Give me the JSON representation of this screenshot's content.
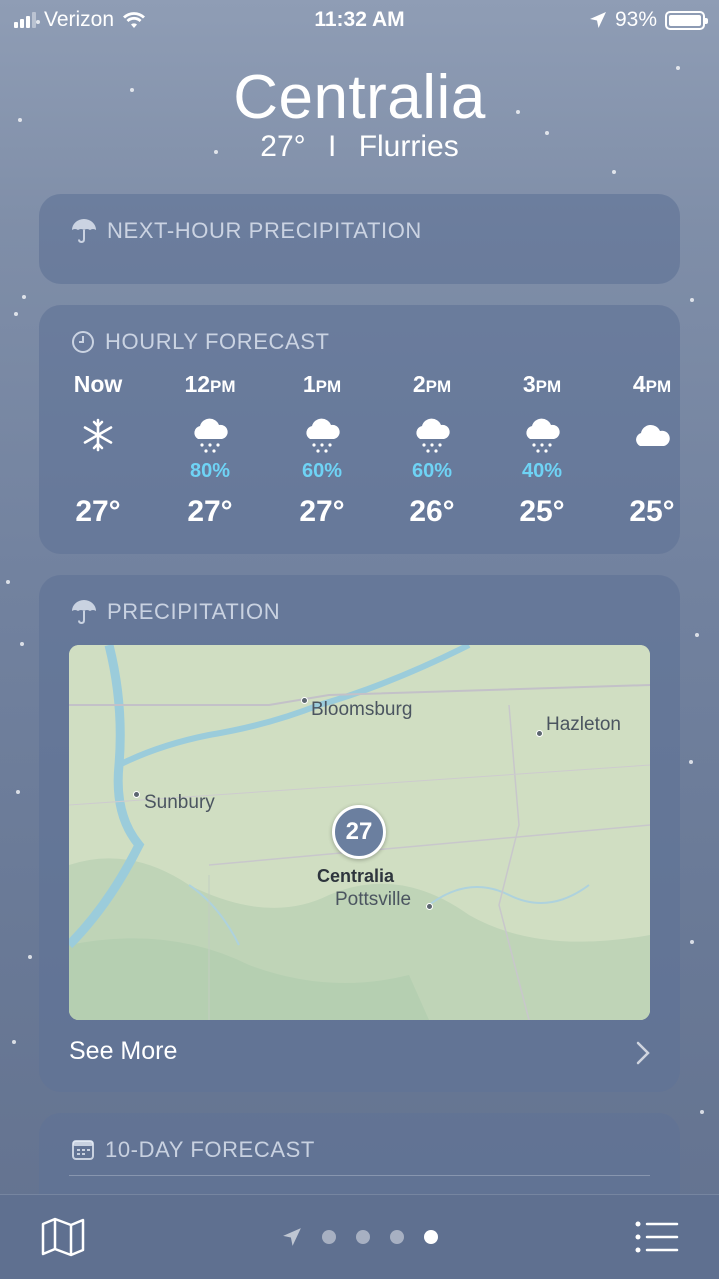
{
  "status_bar": {
    "carrier": "Verizon",
    "time": "11:32 AM",
    "battery": "93%"
  },
  "header": {
    "city": "Centralia",
    "temp": "27°",
    "separator": "I",
    "condition": "Flurries"
  },
  "next_hour": {
    "title": "NEXT-HOUR PRECIPITATION",
    "icon": "umbrella-icon"
  },
  "hourly": {
    "title": "HOURLY FORECAST",
    "icon": "clock-icon",
    "items": [
      {
        "time": "Now",
        "suffix": "",
        "icon": "snowflake-icon",
        "pct": "",
        "temp": "27°"
      },
      {
        "time": "12",
        "suffix": "PM",
        "icon": "snow-cloud-icon",
        "pct": "80%",
        "temp": "27°"
      },
      {
        "time": "1",
        "suffix": "PM",
        "icon": "snow-cloud-icon",
        "pct": "60%",
        "temp": "27°"
      },
      {
        "time": "2",
        "suffix": "PM",
        "icon": "snow-cloud-icon",
        "pct": "60%",
        "temp": "26°"
      },
      {
        "time": "3",
        "suffix": "PM",
        "icon": "snow-cloud-icon",
        "pct": "40%",
        "temp": "25°"
      },
      {
        "time": "4",
        "suffix": "PM",
        "icon": "cloud-icon",
        "pct": "",
        "temp": "25°"
      }
    ]
  },
  "precipitation": {
    "title": "PRECIPITATION",
    "icon": "umbrella-icon",
    "map": {
      "towns": [
        "Bloomsburg",
        "Hazleton",
        "Sunbury",
        "Pottsville"
      ],
      "current_location": "Centralia",
      "current_temp": "27"
    },
    "see_more": "See More"
  },
  "ten_day": {
    "title": "10-DAY FORECAST",
    "icon": "calendar-icon"
  },
  "tab_bar": {
    "pages": 4,
    "active_page": 4
  },
  "colors": {
    "precip_pct": "#6fd3f5",
    "card_bg": "#5f7296"
  }
}
